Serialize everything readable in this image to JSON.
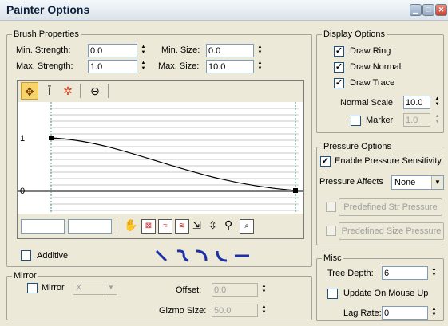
{
  "window": {
    "title": "Painter Options"
  },
  "brush": {
    "legend": "Brush Properties",
    "min_strength_label": "Min. Strength:",
    "min_strength": "0.0",
    "max_strength_label": "Max. Strength:",
    "max_strength": "1.0",
    "min_size_label": "Min. Size:",
    "min_size": "0.0",
    "max_size_label": "Max. Size:",
    "max_size": "10.0",
    "graph_label_top": "1",
    "graph_label_bottom": "0",
    "additive_label": "Additive",
    "additive": false
  },
  "display": {
    "legend": "Display Options",
    "draw_ring_label": "Draw Ring",
    "draw_ring": true,
    "draw_normal_label": "Draw Normal",
    "draw_normal": true,
    "draw_trace_label": "Draw Trace",
    "draw_trace": true,
    "normal_scale_label": "Normal Scale:",
    "normal_scale": "10.0",
    "marker_label": "Marker",
    "marker": "1.0"
  },
  "pressure": {
    "legend": "Pressure Options",
    "enable_label": "Enable Pressure Sensitivity",
    "enable": true,
    "affects_label": "Pressure Affects",
    "affects_value": "None",
    "predefined_str_label": "Predefined Str Pressure",
    "predefined_size_label": "Predefined Size Pressure"
  },
  "misc": {
    "legend": "Misc",
    "tree_depth_label": "Tree Depth:",
    "tree_depth": "6",
    "update_label": "Update On Mouse Up",
    "lag_rate_label": "Lag Rate:",
    "lag_rate": "0"
  },
  "mirror": {
    "legend": "Mirror",
    "mirror_label": "Mirror",
    "axis_value": "X",
    "offset_label": "Offset:",
    "offset": "0.0",
    "gizmo_label": "Gizmo Size:",
    "gizmo": "50.0"
  },
  "colors": {
    "accent": "#1a2fa8",
    "curve": "#000000",
    "grid": "#c8c8c8"
  }
}
